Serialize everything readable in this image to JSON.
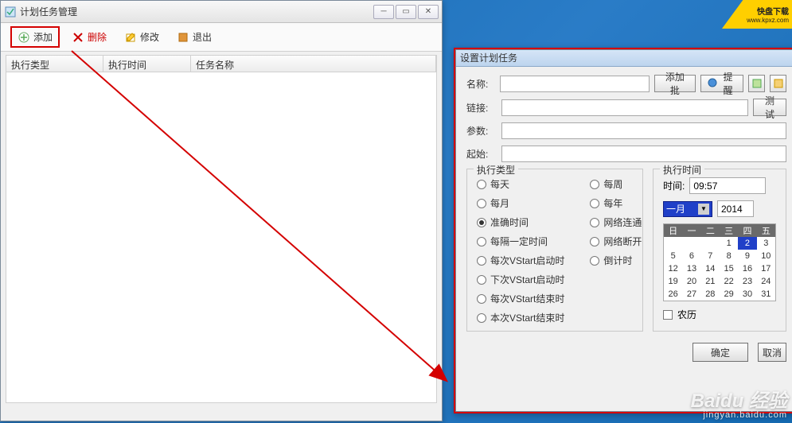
{
  "leftWindow": {
    "title": "计划任务管理",
    "toolbar": {
      "add": "添加",
      "del": "删除",
      "edit": "修改",
      "exit": "退出"
    },
    "columns": [
      "执行类型",
      "执行时间",
      "任务名称"
    ]
  },
  "rightWindow": {
    "title": "设置计划任务",
    "labels": {
      "name": "名称:",
      "link": "链接:",
      "params": "参数:",
      "start": "起始:"
    },
    "buttons": {
      "addBatch": "添加批",
      "remind": "提醒",
      "test": "测试",
      "ok": "确定",
      "cancel": "取消"
    },
    "execType": {
      "legend": "执行类型",
      "options": {
        "daily": "每天",
        "weekly": "每周",
        "monthly": "每月",
        "yearly": "每年",
        "exact": "准确时间",
        "netOn": "网络连通",
        "interval": "每隔一定时间",
        "netOff": "网络断开",
        "eachStart": "每次VStart启动时",
        "countdown": "倒计时",
        "nextStart": "下次VStart启动时",
        "eachEnd": "每次VStart结束时",
        "thisEnd": "本次VStart结束时"
      },
      "selected": "exact"
    },
    "execTime": {
      "legend": "执行时间",
      "timeLabel": "时间:",
      "timeValue": "09:57",
      "month": "一月",
      "year": "2014",
      "weekdays": [
        "日",
        "一",
        "二",
        "三",
        "四",
        "五"
      ],
      "days": [
        [
          "",
          "",
          "",
          "1",
          "2",
          "3"
        ],
        [
          "5",
          "6",
          "7",
          "8",
          "9",
          "10"
        ],
        [
          "12",
          "13",
          "14",
          "15",
          "16",
          "17"
        ],
        [
          "19",
          "20",
          "21",
          "22",
          "23",
          "24"
        ],
        [
          "26",
          "27",
          "28",
          "29",
          "30",
          "31"
        ]
      ],
      "selectedDay": "2",
      "lunar": "农历"
    }
  },
  "watermark": {
    "main": "Baidu 经验",
    "sub": "jingyan.baidu.com"
  },
  "badge": {
    "line1": "快盘下载",
    "line2": "www.kpxz.com"
  }
}
